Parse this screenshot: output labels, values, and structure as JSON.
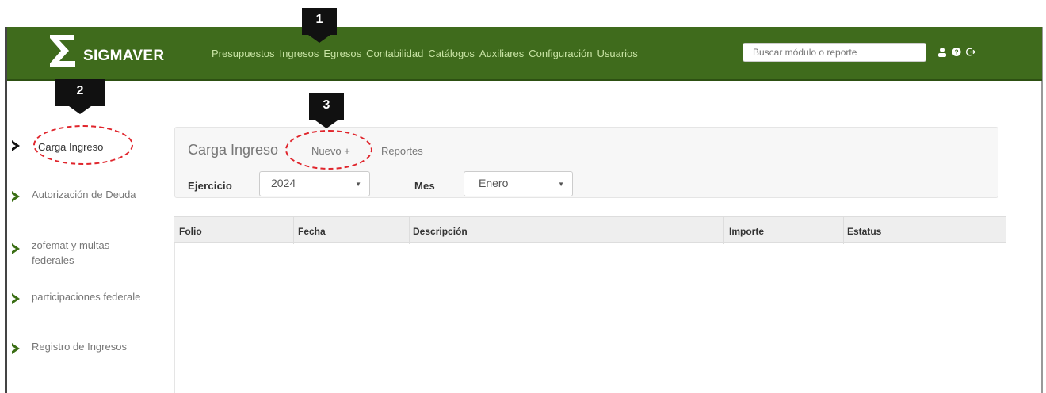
{
  "app": {
    "name": "SIGMAVER",
    "nav": [
      "Presupuestos",
      "Ingresos",
      "Egresos",
      "Contabilidad",
      "Catálogos",
      "Auxiliares",
      "Configuración",
      "Usuarios"
    ],
    "search_placeholder": "Buscar módulo o reporte",
    "icons": [
      "user-icon",
      "help-icon",
      "logout-icon"
    ]
  },
  "markers": [
    "1",
    "2",
    "3"
  ],
  "sidebar": {
    "items": [
      {
        "label": "Carga Ingreso",
        "active": true
      },
      {
        "label": "Autorización de Deuda"
      },
      {
        "label": "zofemat y multas federales"
      },
      {
        "label": "participaciones federale"
      },
      {
        "label": "Registro de Ingresos"
      }
    ]
  },
  "panel": {
    "title": "Carga Ingreso",
    "new_label": "Nuevo +",
    "reports_label": "Reportes",
    "year_label": "Ejercicio",
    "year_value": "2024",
    "month_label": "Mes",
    "month_value": "Enero"
  },
  "table": {
    "columns": [
      "Folio",
      "Fecha",
      "Descripción",
      "Importe",
      "Estatus"
    ]
  },
  "colors": {
    "topbar": "#3f6b1c",
    "nav_text": "#c8e3a4",
    "highlight": "#e0252c",
    "chevron": "#3a6e14"
  }
}
